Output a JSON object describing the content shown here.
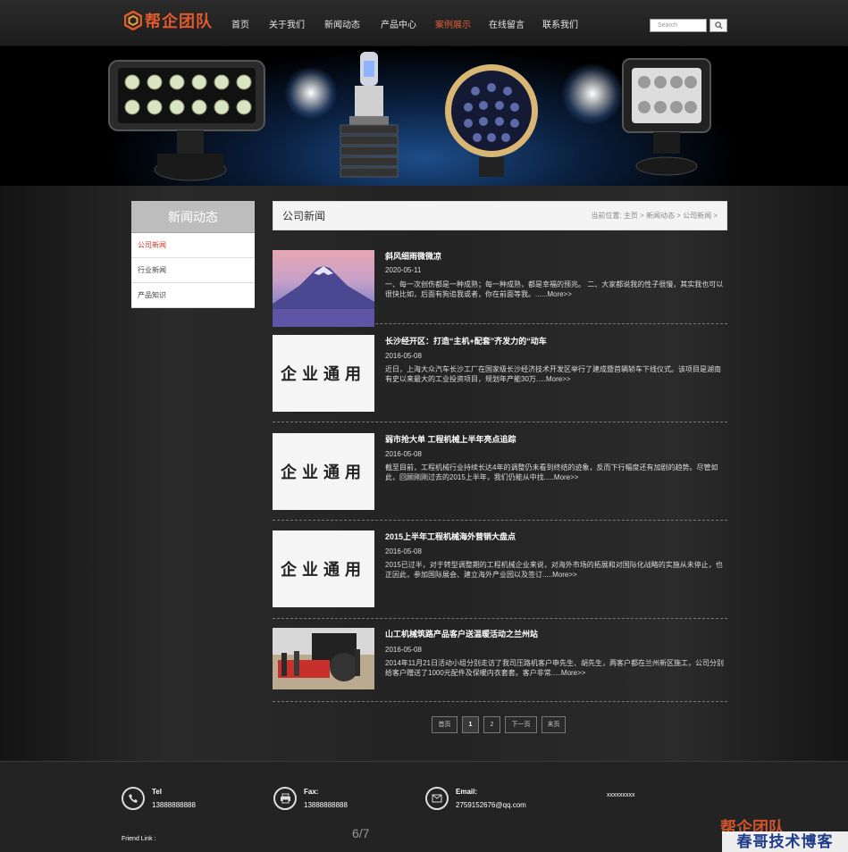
{
  "header": {
    "logo_text": "帮企团队",
    "nav": [
      "首页",
      "关于我们",
      "新闻动态",
      "产品中心",
      "案例展示",
      "在线留言",
      "联系我们"
    ],
    "active_nav": "案例展示",
    "search_placeholder": "Search"
  },
  "sidebar": {
    "title": "新闻动态",
    "items": [
      "公司新闻",
      "行业新闻",
      "产品知识"
    ],
    "active_item": "公司新闻"
  },
  "content": {
    "title": "公司新闻",
    "breadcrumb": "当前位置: 主页 > 新闻动态 > 公司新闻 >"
  },
  "news": [
    {
      "title": "斜风细雨微微凉",
      "date": "2020-05-11",
      "desc": "一、每一次创伤都是一种成熟；每一种成熟，都是幸福的预兆。 二、大家都说我的性子很慢，其实我也可以很快比如，后面有狗追我或者，你在前面等我。......More>>",
      "thumb": "mountain-photo"
    },
    {
      "title": "长沙经开区：打造“主机+配套”齐发力的“动车",
      "date": "2016-05-08",
      "desc": "近日，上海大众汽车长沙工厂在国家级长沙经济技术开发区举行了建成暨首辆轿车下线仪式。该项目是湖南有史以来最大的工业投资项目，规划年产能30万.....More>>",
      "thumb": "placeholder",
      "thumb_text": "企业通用"
    },
    {
      "title": "弱市抢大单 工程机械上半年亮点追踪",
      "date": "2016-05-08",
      "desc": "截至目前，工程机械行业持续长达4年的调整仍未看到终结的迹象，反而下行幅度还有加剧的趋势。尽管如此，回顾刚刚过去的2015上半年，我们仍能从中找.....More>>",
      "thumb": "placeholder",
      "thumb_text": "企业通用"
    },
    {
      "title": "2015上半年工程机械海外营销大盘点",
      "date": "2016-05-08",
      "desc": "2015已过半，对于转型调整期的工程机械企业来说，对海外市场的拓展和对国际化战略的实施从未停止，也正因此，参加国际展会、建立海外产业园以及签订.....More>>",
      "thumb": "placeholder",
      "thumb_text": "企业通用"
    },
    {
      "title": "山工机械筑路产品客户送温暖活动之兰州站",
      "date": "2016-05-08",
      "desc": "2014年11月21日活动小组分别走访了我司压路机客户申先生、胡先生，两客户都在兰州新区施工，公司分别给客户赠送了1000元配件及保暖内衣套套。客户非常.....More>>",
      "thumb": "machine-photo"
    }
  ],
  "pager": {
    "first": "首页",
    "pages": [
      "1",
      "2"
    ],
    "current": "1",
    "next": "下一页",
    "last": "末页"
  },
  "footer": {
    "tel_label": "Tel",
    "tel_value": "13888888888",
    "fax_label": "Fax:",
    "fax_value": "13888888888",
    "email_label": "Email:",
    "email_value": "2759152676@qq.com",
    "extra": "xxxxxxxxx",
    "friend_link": "Friend Link :",
    "page_counter": "6/7",
    "watermark": "春哥技术博客",
    "watermark_logo": "帮企团队"
  }
}
